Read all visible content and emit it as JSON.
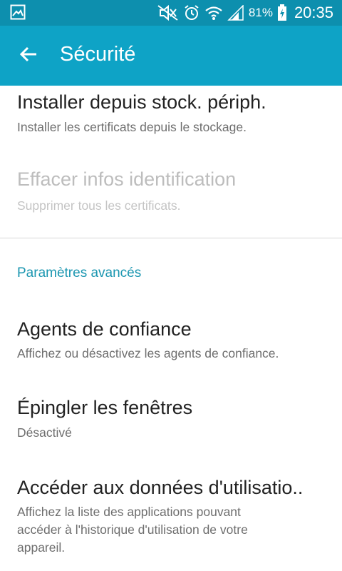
{
  "status_bar": {
    "battery_percent": "81%",
    "time": "20:35",
    "icons": [
      "gallery-icon",
      "mute-icon",
      "alarm-icon",
      "wifi-icon",
      "signal-icon",
      "battery-charging-icon"
    ]
  },
  "app_bar": {
    "title": "Sécurité",
    "back_icon": "arrow-left-icon"
  },
  "items": [
    {
      "title": "Installer depuis stock. périph.",
      "subtitle": "Installer les certificats depuis le stockage.",
      "enabled": true
    },
    {
      "title": "Effacer infos identification",
      "subtitle": "Supprimer tous les certificats.",
      "enabled": false
    }
  ],
  "advanced_section": {
    "header": "Paramètres avancés",
    "items": [
      {
        "title": "Agents de confiance",
        "subtitle": "Affichez ou désactivez les agents de confiance."
      },
      {
        "title": "Épingler les fenêtres",
        "subtitle": "Désactivé"
      },
      {
        "title": "Accéder aux données d'utilisatio..",
        "subtitle_lines": [
          "Affichez la liste des applications pouvant",
          "accéder à l'historique d'utilisation de votre",
          "appareil."
        ]
      }
    ]
  },
  "colors": {
    "status_bar": "#0D8FAE",
    "app_bar": "#0EA3C6",
    "section_header": "#1A96B0"
  }
}
